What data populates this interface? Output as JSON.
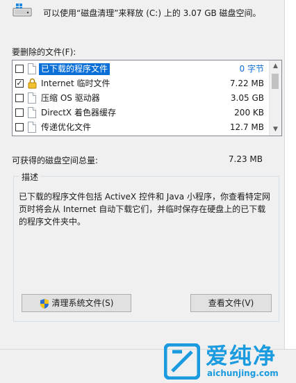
{
  "header": {
    "text": "可以使用“磁盘清理”来释放  (C:) 上的 3.07 GB 磁盘空间。"
  },
  "files_label": "要删除的文件(F):",
  "files": [
    {
      "name": "已下载的程序文件",
      "size": "0 字节",
      "checked": false,
      "icon": "file-icon",
      "selected": true
    },
    {
      "name": "Internet 临时文件",
      "size": "7.22 MB",
      "checked": true,
      "icon": "lock-icon",
      "selected": false
    },
    {
      "name": "压缩 OS 驱动器",
      "size": "3.05 GB",
      "checked": false,
      "icon": "file-icon",
      "selected": false
    },
    {
      "name": "DirectX 着色器缓存",
      "size": "200 KB",
      "checked": false,
      "icon": "file-icon",
      "selected": false
    },
    {
      "name": "传递优化文件",
      "size": "12.7 MB",
      "checked": false,
      "icon": "file-icon",
      "selected": false
    }
  ],
  "total": {
    "label": "可获得的磁盘空间总量:",
    "value": "7.23 MB"
  },
  "description": {
    "title": "描述",
    "text": "已下载的程序文件包括 ActiveX 控件和 Java 小程序，你查看特定网页时将会从 Internet 自动下载它们，并临时保存在硬盘上的已下载的程序文件夹中。"
  },
  "buttons": {
    "clean_system": "清理系统文件(S)",
    "view_files": "查看文件(V)"
  },
  "watermark": {
    "title": "爱纯净",
    "url": "aichunjing.com"
  },
  "colors": {
    "selection": "#0a6fd6",
    "panel": "#f0f0f0",
    "watermark": "#1a9be0"
  }
}
